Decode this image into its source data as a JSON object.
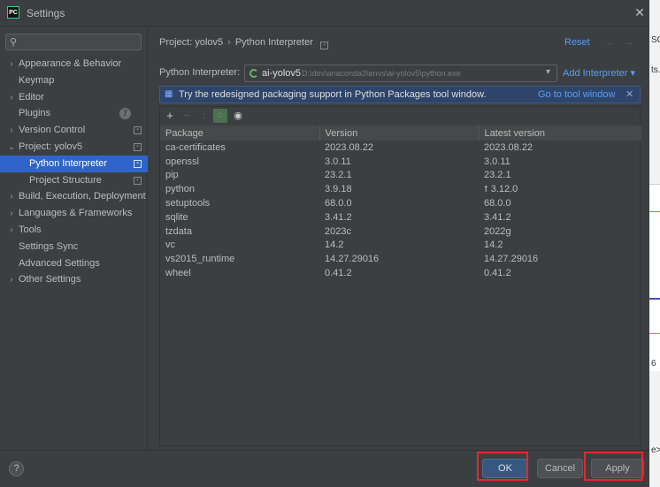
{
  "window": {
    "title": "Settings",
    "app_icon_text": "PC"
  },
  "search": {
    "placeholder": ""
  },
  "sidebar": {
    "items": [
      {
        "label": "Appearance & Behavior",
        "expandable": true
      },
      {
        "label": "Keymap"
      },
      {
        "label": "Editor",
        "expandable": true
      },
      {
        "label": "Plugins",
        "badge": "7"
      },
      {
        "label": "Version Control",
        "expandable": true
      },
      {
        "label": "Project: yolov5",
        "expandable": true,
        "expanded": true
      },
      {
        "label": "Python Interpreter",
        "child": true,
        "selected": true
      },
      {
        "label": "Project Structure",
        "child": true
      },
      {
        "label": "Build, Execution, Deployment",
        "expandable": true
      },
      {
        "label": "Languages & Frameworks",
        "expandable": true
      },
      {
        "label": "Tools",
        "expandable": true
      },
      {
        "label": "Settings Sync"
      },
      {
        "label": "Advanced Settings"
      },
      {
        "label": "Other Settings",
        "expandable": true
      }
    ]
  },
  "breadcrumb": {
    "project": "Project: yolov5",
    "page": "Python Interpreter"
  },
  "header": {
    "reset_label": "Reset"
  },
  "interpreter": {
    "label": "Python Interpreter:",
    "name": "ai-yolov5",
    "path": "D:\\dev\\anaconda3\\envs\\ai-yolov5\\python.exe",
    "add_label": "Add Interpreter"
  },
  "banner": {
    "text": "Try the redesigned packaging support in Python Packages tool window.",
    "link": "Go to tool window"
  },
  "packages": {
    "columns": [
      "Package",
      "Version",
      "Latest version"
    ],
    "rows": [
      {
        "name": "ca-certificates",
        "version": "2023.08.22",
        "latest": "2023.08.22",
        "upgrade": false
      },
      {
        "name": "openssl",
        "version": "3.0.11",
        "latest": "3.0.11",
        "upgrade": false
      },
      {
        "name": "pip",
        "version": "23.2.1",
        "latest": "23.2.1",
        "upgrade": false
      },
      {
        "name": "python",
        "version": "3.9.18",
        "latest": "3.12.0",
        "upgrade": true
      },
      {
        "name": "setuptools",
        "version": "68.0.0",
        "latest": "68.0.0",
        "upgrade": false
      },
      {
        "name": "sqlite",
        "version": "3.41.2",
        "latest": "3.41.2",
        "upgrade": false
      },
      {
        "name": "tzdata",
        "version": "2023c",
        "latest": "2022g",
        "upgrade": false
      },
      {
        "name": "vc",
        "version": "14.2",
        "latest": "14.2",
        "upgrade": false
      },
      {
        "name": "vs2015_runtime",
        "version": "14.27.29016",
        "latest": "14.27.29016",
        "upgrade": false
      },
      {
        "name": "wheel",
        "version": "0.41.2",
        "latest": "0.41.2",
        "upgrade": false
      }
    ]
  },
  "buttons": {
    "help": "?",
    "ok": "OK",
    "cancel": "Cancel",
    "apply": "Apply"
  },
  "background_window": {
    "snippets": [
      "SC",
      "ts.",
      "6",
      "e>"
    ]
  },
  "colors": {
    "accent": "#2f65ca",
    "link": "#589df6",
    "highlight_box": "#e8262b",
    "ok_button": "#365880"
  }
}
